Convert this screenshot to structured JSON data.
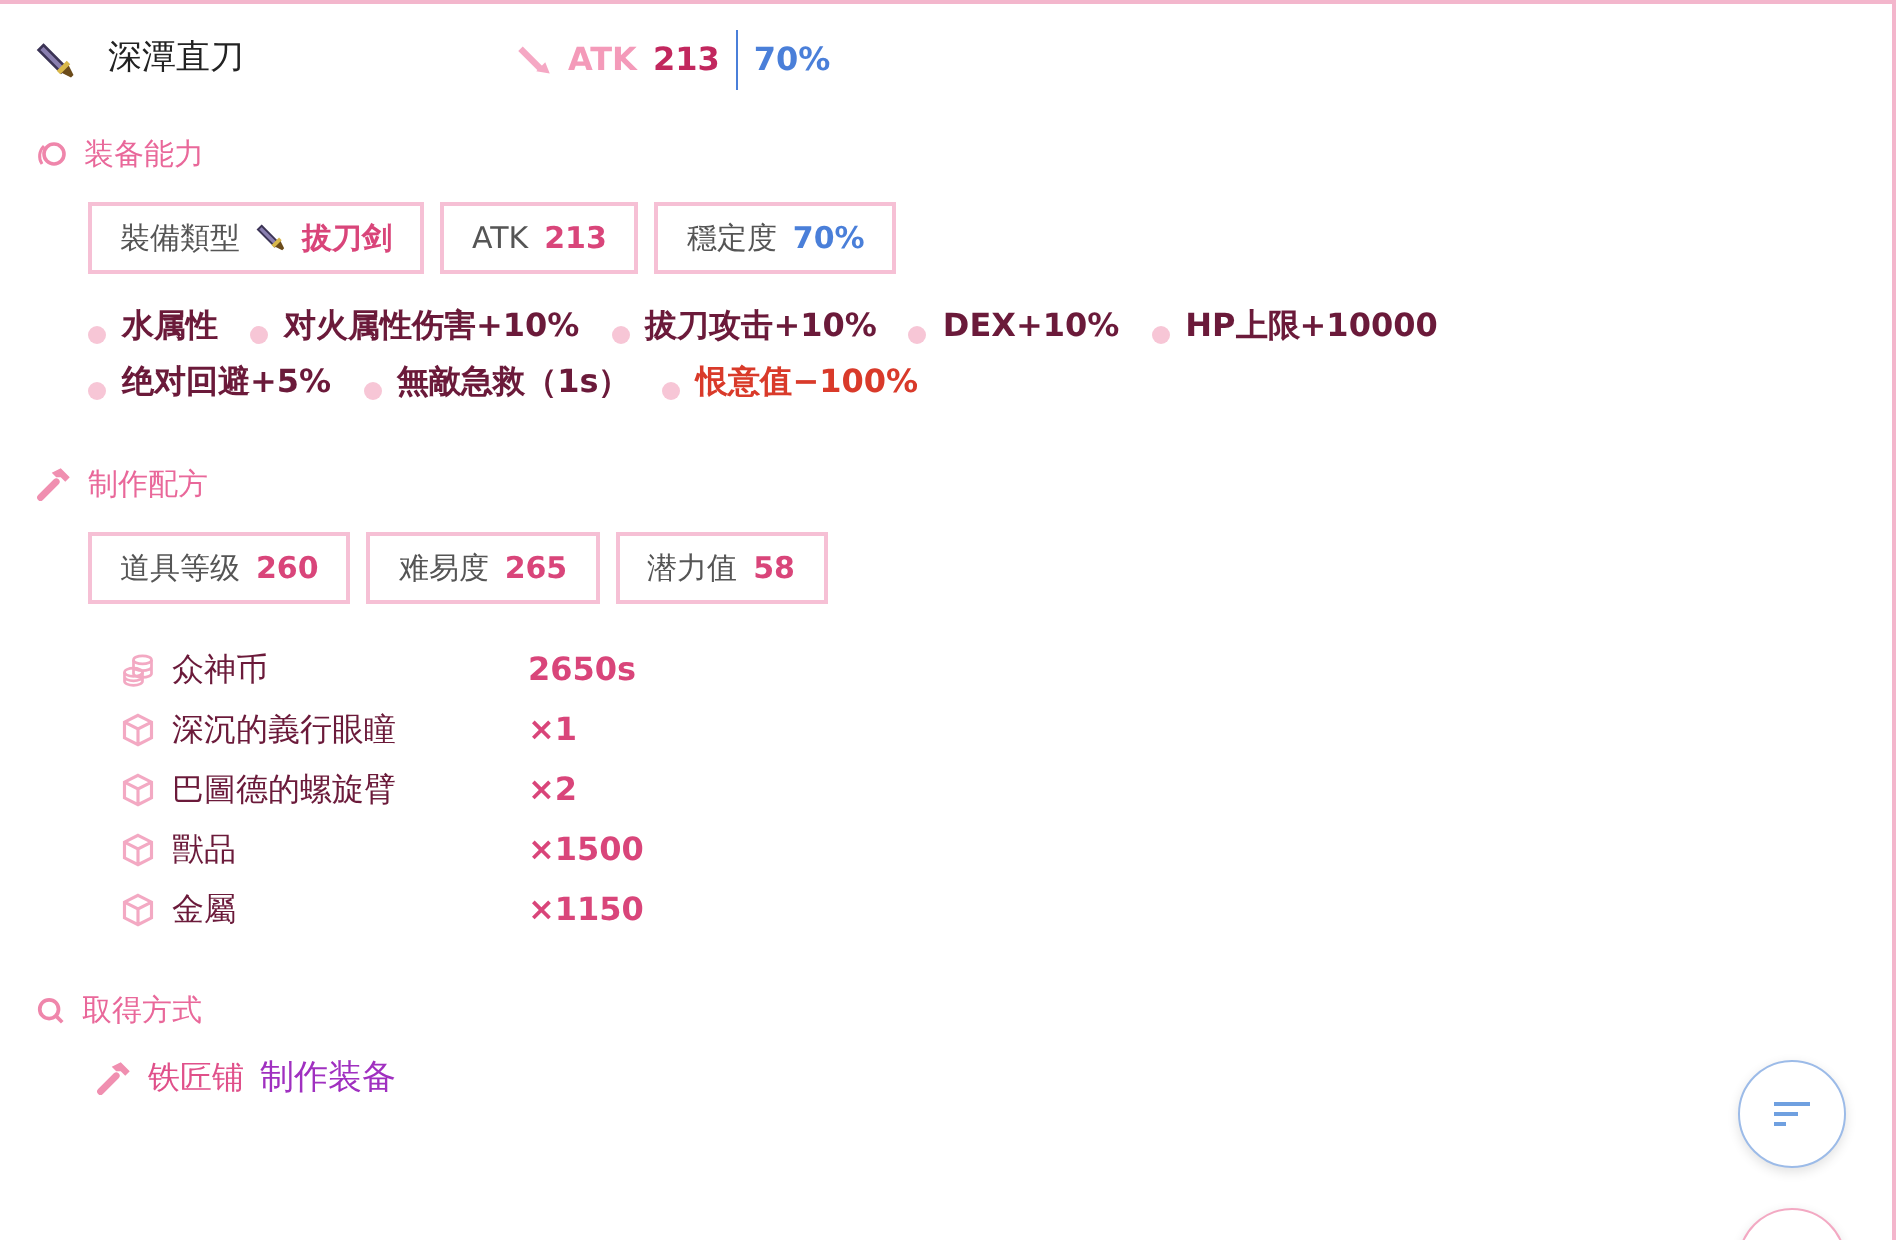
{
  "item": {
    "name": "深潭直刀",
    "atk_label": "ATK",
    "atk_value": "213",
    "stability": "70%"
  },
  "ability": {
    "title": "装备能力",
    "chips": [
      {
        "label": "裝備類型",
        "value": "拔刀剑",
        "kind": "type"
      },
      {
        "label": "ATK",
        "value": "213",
        "kind": "stat"
      },
      {
        "label": "穩定度",
        "value": "70%",
        "kind": "stability"
      }
    ],
    "effects": [
      {
        "text": "水属性",
        "kind": "normal"
      },
      {
        "text": "对火属性伤害+10%",
        "kind": "normal"
      },
      {
        "text": "拔刀攻击+10%",
        "kind": "normal"
      },
      {
        "text": "DEX+10%",
        "kind": "normal"
      },
      {
        "text": "HP上限+10000",
        "kind": "normal"
      },
      {
        "text": "绝对回避+5%",
        "kind": "normal"
      },
      {
        "text": "無敵急救（1s）",
        "kind": "normal"
      },
      {
        "text": "恨意值−100%",
        "kind": "penalty"
      }
    ]
  },
  "recipe": {
    "title": "制作配方",
    "chips": [
      {
        "label": "道具等级",
        "value": "260",
        "kind": "stat"
      },
      {
        "label": "难易度",
        "value": "265",
        "kind": "stat"
      },
      {
        "label": "潜力值",
        "value": "58",
        "kind": "stat"
      }
    ],
    "materials": [
      {
        "kind": "coin",
        "name": "众神币",
        "amount": "2650s"
      },
      {
        "kind": "item",
        "name": "深沉的義行眼瞳",
        "amount": "×1"
      },
      {
        "kind": "item",
        "name": "巴圖德的螺旋臂",
        "amount": "×2"
      },
      {
        "kind": "item",
        "name": "獸品",
        "amount": "×1500"
      },
      {
        "kind": "item",
        "name": "金屬",
        "amount": "×1150"
      }
    ]
  },
  "obtain": {
    "title": "取得方式",
    "source": "铁匠铺",
    "method": "制作装备"
  }
}
